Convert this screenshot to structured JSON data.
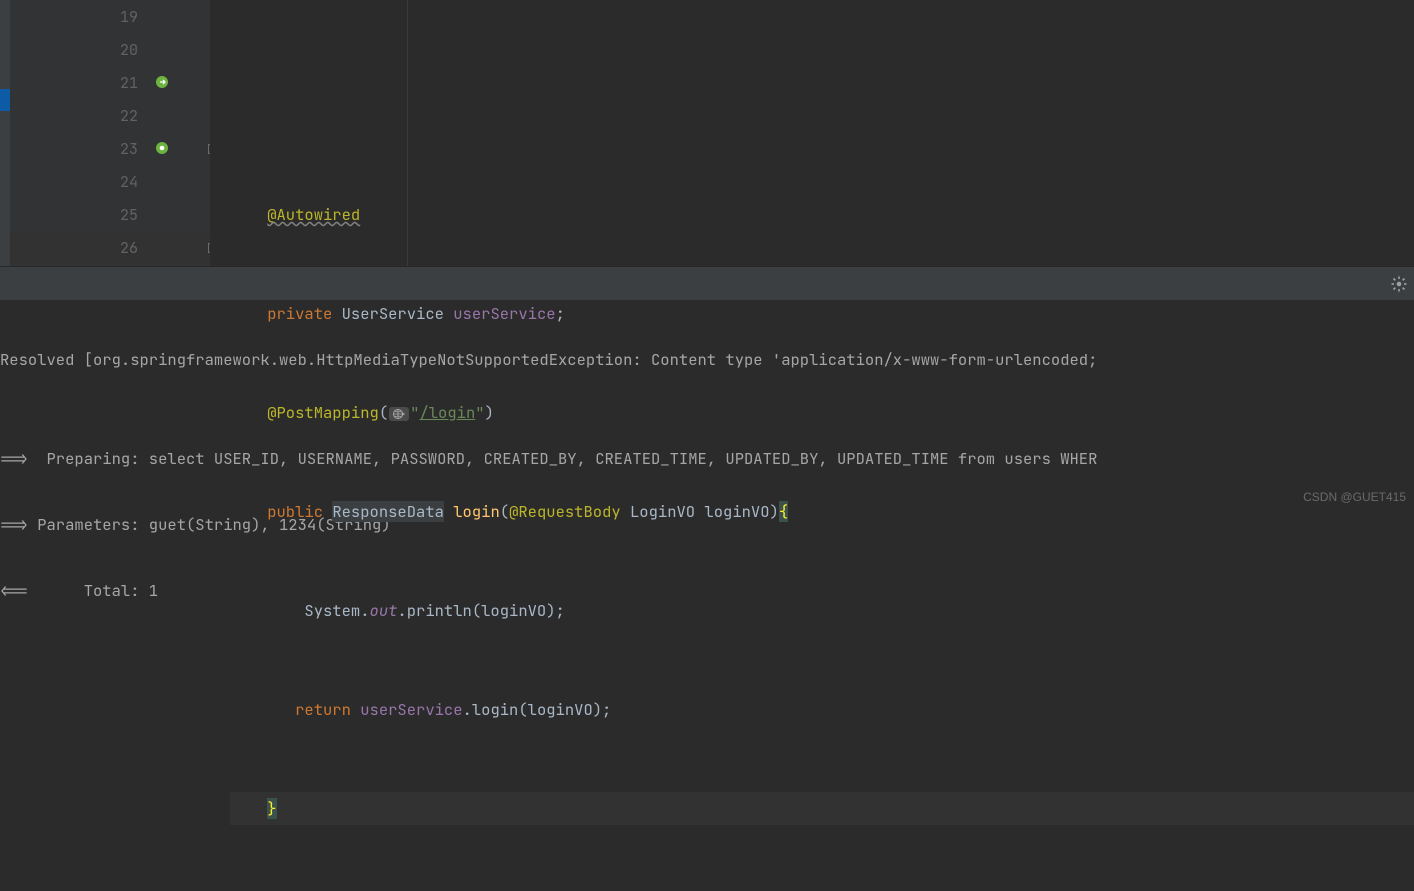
{
  "gutter": {
    "lines": [
      "19",
      "20",
      "21",
      "22",
      "23",
      "24",
      "25",
      "26"
    ]
  },
  "code": {
    "l20_annotation": "@Autowired",
    "l21_keyword": "private",
    "l21_type": "UserService",
    "l21_field": "userService",
    "l21_semi": ";",
    "l22_annotation": "@PostMapping",
    "l22_open": "(",
    "l22_string_open": "\"",
    "l22_path": "/login",
    "l22_string_close": "\"",
    "l22_close": ")",
    "l23_keyword": "public",
    "l23_type": "ResponseData",
    "l23_method": "login",
    "l23_open": "(",
    "l23_ann": "@RequestBody",
    "l23_ptype": "LoginVO",
    "l23_pname": "loginVO",
    "l23_close": ")",
    "l23_brace": "{",
    "l24_a": "System.",
    "l24_out": "out",
    "l24_b": ".println(loginVO);",
    "l25_return": "return",
    "l25_field": "userService",
    "l25_call": ".login(loginVO);",
    "l26_brace": "}"
  },
  "console": {
    "line1": "Resolved [org.springframework.web.HttpMediaTypeNotSupportedException: Content type 'application/x-www-form-urlencoded;",
    "blank": "",
    "line2": "==>  Preparing: select USER_ID, USERNAME, PASSWORD, CREATED_BY, CREATED_TIME, UPDATED_BY, UPDATED_TIME from users WHER",
    "line3": "==> Parameters: guet(String), 1234(String)",
    "line4": "<==      Total: 1"
  },
  "watermark": "CSDN @GUET415"
}
